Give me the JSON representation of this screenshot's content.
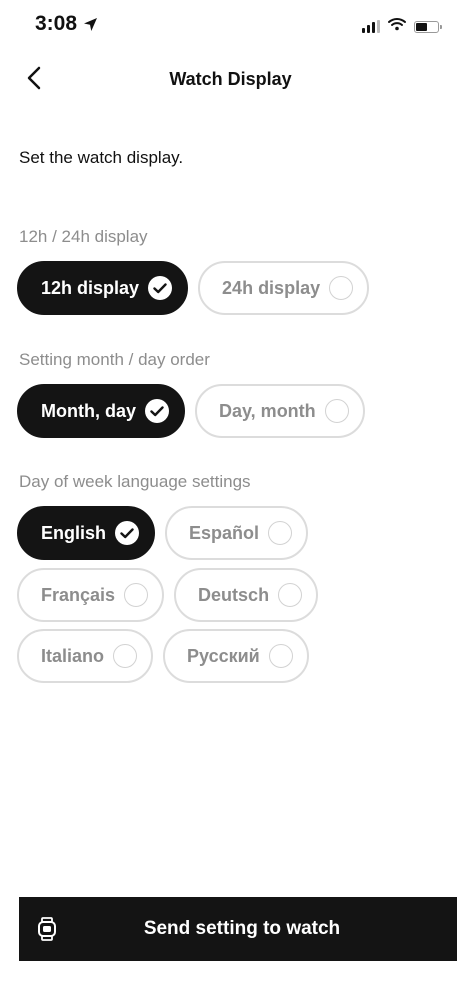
{
  "status_bar": {
    "time": "3:08",
    "icons": [
      "location-arrow-icon",
      "cellular-signal-icon",
      "wifi-icon",
      "battery-icon"
    ]
  },
  "nav": {
    "title": "Watch Display",
    "back_icon": "chevron-left-icon"
  },
  "intro": "Set the watch display.",
  "sections": {
    "time_format": {
      "label": "12h / 24h display",
      "options": [
        {
          "label": "12h display",
          "selected": true
        },
        {
          "label": "24h display",
          "selected": false
        }
      ]
    },
    "date_order": {
      "label": "Setting month / day order",
      "options": [
        {
          "label": "Month, day",
          "selected": true
        },
        {
          "label": "Day, month",
          "selected": false
        }
      ]
    },
    "language": {
      "label": "Day of week language settings",
      "options": [
        {
          "label": "English",
          "selected": true
        },
        {
          "label": "Español",
          "selected": false
        },
        {
          "label": "Français",
          "selected": false
        },
        {
          "label": "Deutsch",
          "selected": false
        },
        {
          "label": "Italiano",
          "selected": false
        },
        {
          "label": "Русский",
          "selected": false
        }
      ]
    }
  },
  "send_button": {
    "label": "Send setting to watch",
    "icon": "watch-icon"
  },
  "colors": {
    "selected_bg": "#141414",
    "unselected_text": "#8d8d8d",
    "unselected_border": "#dcdcdc"
  }
}
